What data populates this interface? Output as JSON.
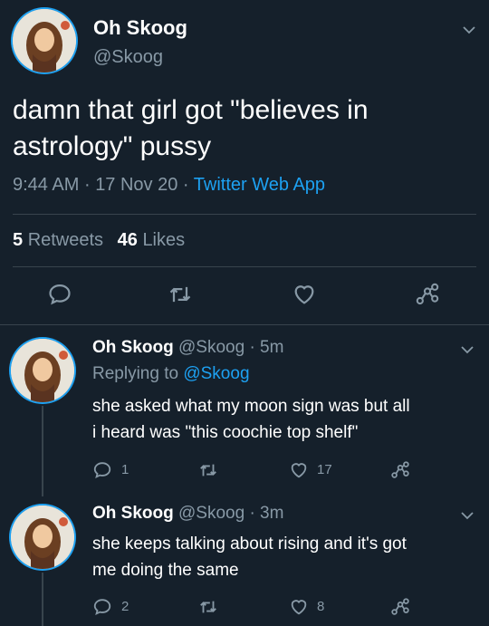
{
  "main_tweet": {
    "display_name": "Oh Skoog",
    "handle": "@Skoog",
    "text_line1": "damn that girl got \"believes in",
    "text_line2": "astrology\" pussy",
    "time": "9:44 AM",
    "date": "17 Nov 20",
    "source": "Twitter Web App",
    "sep": "·",
    "retweets_count": "5",
    "retweets_label": "Retweets",
    "likes_count": "46",
    "likes_label": "Likes"
  },
  "replies": [
    {
      "display_name": "Oh Skoog",
      "handle_time": "@Skoog · 5m",
      "replying_label": "Replying to",
      "replying_handle": "@Skoog",
      "text_line1": "she asked what my moon sign was but all",
      "text_line2": "i heard was \"this coochie top shelf\"",
      "reply_count": "1",
      "like_count": "17"
    },
    {
      "display_name": "Oh Skoog",
      "handle_time": "@Skoog · 3m",
      "text_line1": "she keeps talking about rising and it's got",
      "text_line2": "me doing the same",
      "reply_count": "2",
      "like_count": "8"
    }
  ],
  "icons": [
    "reply-icon",
    "retweet-icon",
    "like-icon",
    "share-icon",
    "chevron-down-icon",
    "avatar"
  ],
  "colors": {
    "background": "#15202b",
    "accent": "#1da1f2",
    "muted": "#8899a6",
    "divider": "#38444d"
  }
}
